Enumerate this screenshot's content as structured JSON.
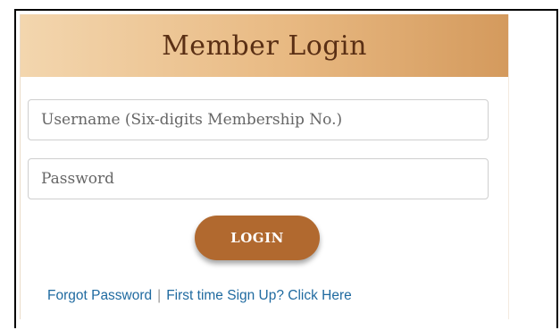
{
  "login_panel": {
    "title": "Member Login",
    "username_placeholder": "Username (Six-digits Membership No.)",
    "password_placeholder": "Password",
    "login_button_label": "LOGIN",
    "forgot_password_link": "Forgot Password",
    "separator": "|",
    "signup_link": "First time Sign Up? Click Here"
  },
  "colors": {
    "header_gradient_start": "#f3d6ae",
    "header_gradient_end": "#d49a5d",
    "title_text": "#5a2f14",
    "button_bg": "#b1692f",
    "link": "#1f6aa0"
  }
}
